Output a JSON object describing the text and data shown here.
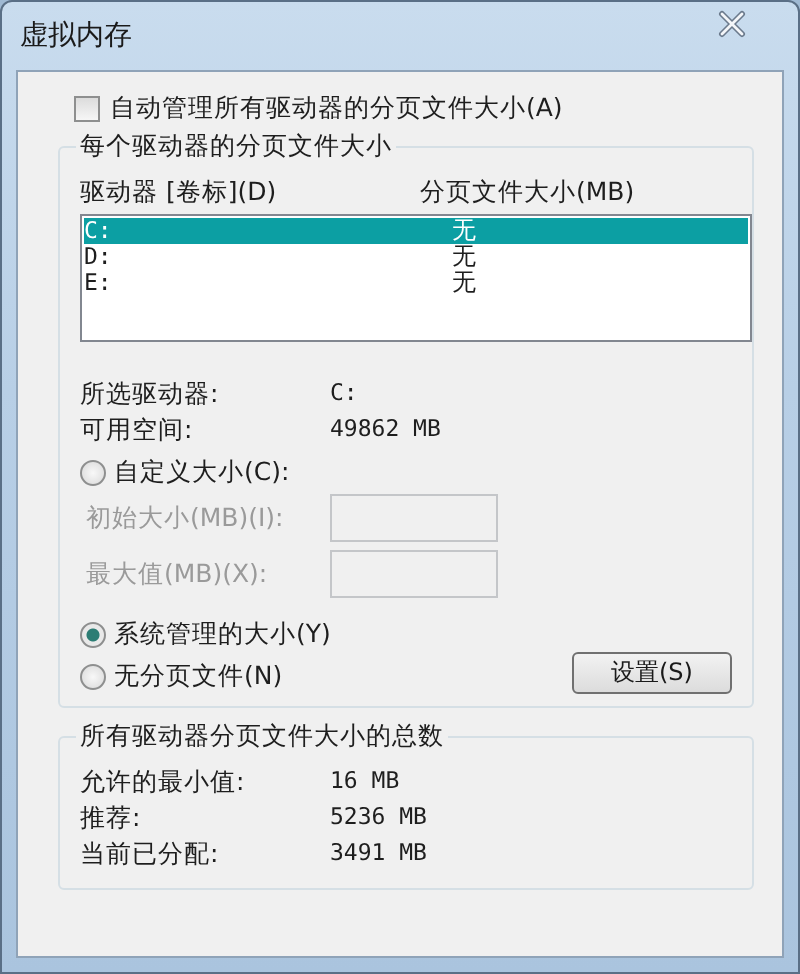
{
  "window": {
    "title": "虚拟内存"
  },
  "auto_manage": {
    "label": "自动管理所有驱动器的分页文件大小(A)",
    "checked": false
  },
  "per_drive": {
    "title": "每个驱动器的分页文件大小",
    "columns": [
      "驱动器 [卷标](D)",
      "分页文件大小(MB)"
    ],
    "rows": [
      {
        "drive": "C:",
        "size": "无",
        "selected": true
      },
      {
        "drive": "D:",
        "size": "无",
        "selected": false
      },
      {
        "drive": "E:",
        "size": "无",
        "selected": false
      }
    ],
    "info": [
      {
        "label": "所选驱动器:",
        "value": "C:"
      },
      {
        "label": "可用空间:",
        "value": "49862 MB"
      }
    ],
    "options": [
      {
        "label": "自定义大小(C):",
        "selected": false
      },
      {
        "label": "系统管理的大小(Y)",
        "selected": true
      },
      {
        "label": "无分页文件(N)",
        "selected": false
      }
    ],
    "size_fields": [
      {
        "label": "初始大小(MB)(I):",
        "disabled": true
      },
      {
        "label": "最大值(MB)(X):",
        "disabled": true
      }
    ],
    "set_button": "设置(S)"
  },
  "totals": {
    "title": "所有驱动器分页文件大小的总数",
    "rows": [
      {
        "label": "允许的最小值:",
        "value": "16 MB"
      },
      {
        "label": "推荐:",
        "value": "5236 MB"
      },
      {
        "label": "当前已分配:",
        "value": "3491 MB"
      }
    ]
  }
}
